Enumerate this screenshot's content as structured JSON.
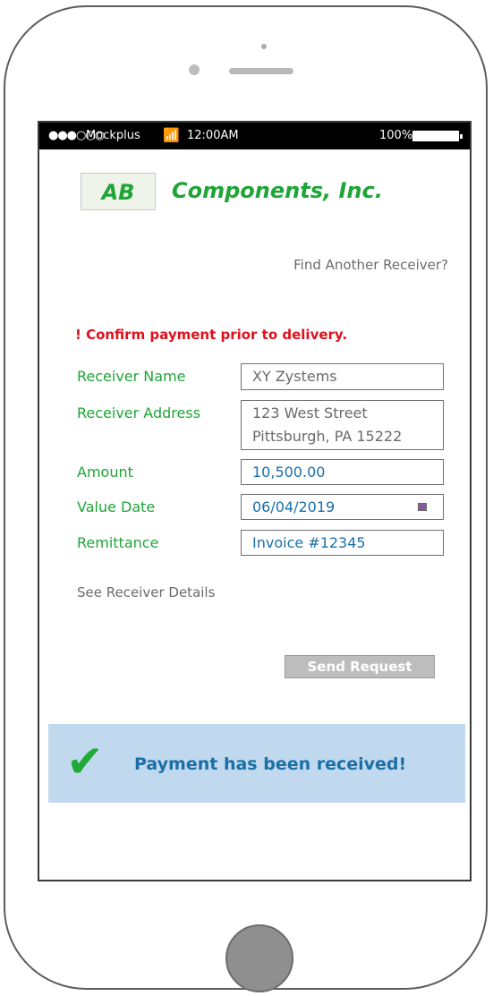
{
  "statusbar": {
    "signal": "●●●○○○",
    "carrier": "Mockplus",
    "time": "12:00AM",
    "battery": "100%"
  },
  "brand": {
    "logo_mark": "AB",
    "name": "Components, Inc.",
    "color": "#1fa537"
  },
  "links": {
    "find_another": "Find Another Receiver?",
    "see_details": "See Receiver Details"
  },
  "warning": "! Confirm payment prior to delivery.",
  "form": {
    "receiver_name": {
      "label": "Receiver Name",
      "value": "XY Zystems"
    },
    "receiver_address": {
      "label": "Receiver Address",
      "line1": "123 West Street",
      "line2": "Pittsburgh, PA 15222"
    },
    "amount": {
      "label": "Amount",
      "value": "10,500.00"
    },
    "value_date": {
      "label": "Value Date",
      "value": "06/04/2019"
    },
    "remittance": {
      "label": "Remittance",
      "value": "Invoice #12345"
    }
  },
  "actions": {
    "send_request": "Send Request"
  },
  "banner": {
    "icon": "checkmark-icon",
    "message": "Payment has been received!",
    "background": "#c1d9ee"
  }
}
